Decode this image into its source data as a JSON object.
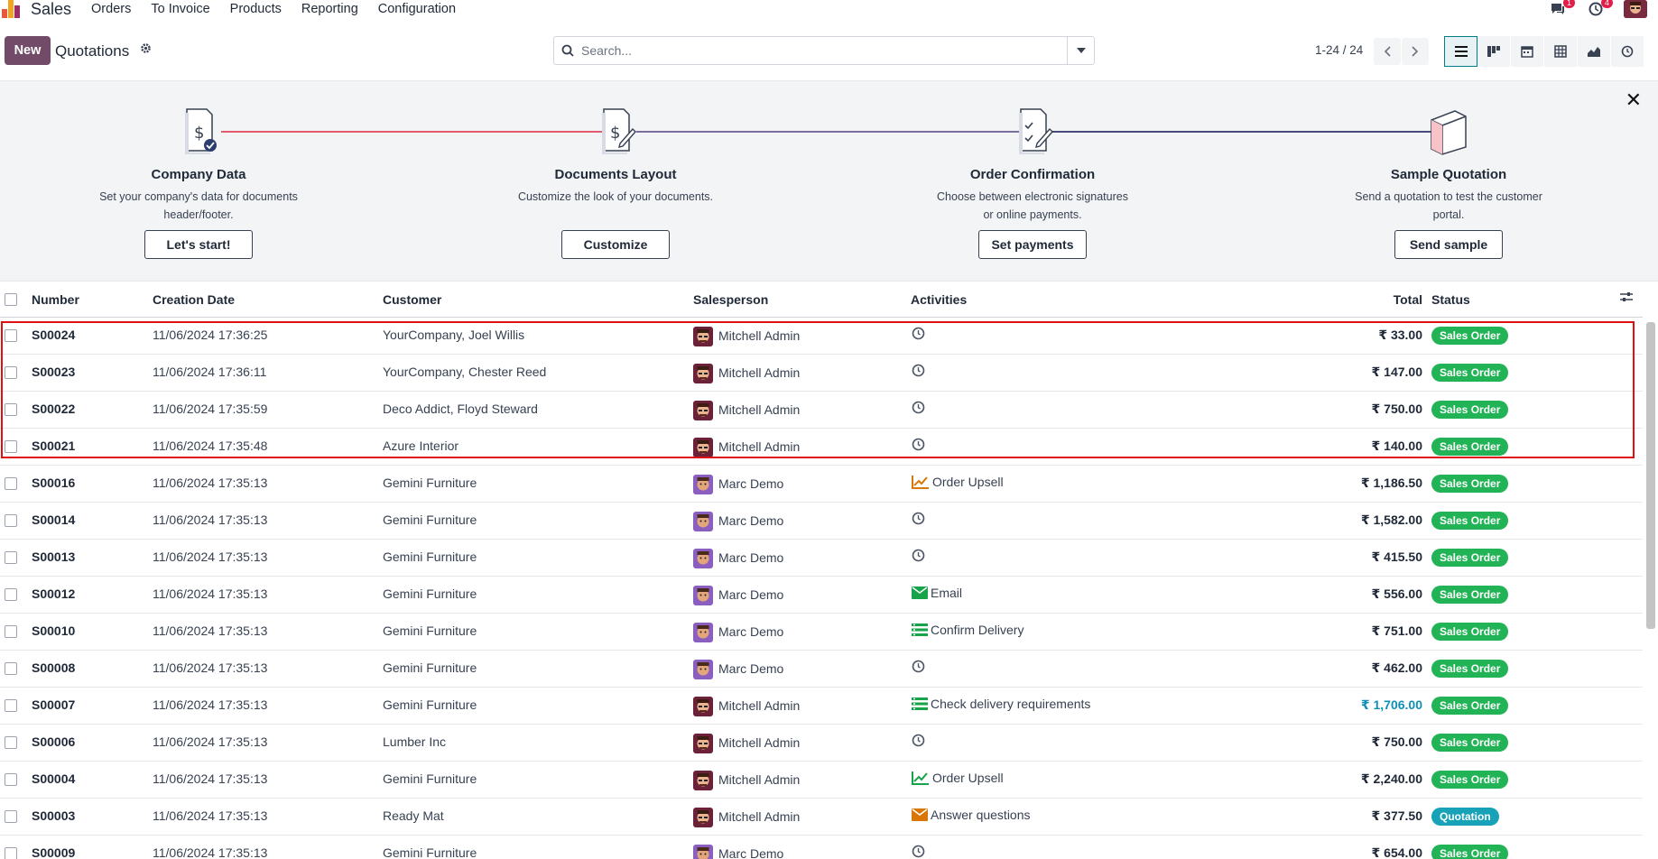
{
  "nav": {
    "app_name": "Sales",
    "menu": [
      "Orders",
      "To Invoice",
      "Products",
      "Reporting",
      "Configuration"
    ],
    "messages_badge": "1",
    "activities_badge": "4"
  },
  "control": {
    "new_label": "New",
    "title": "Quotations",
    "search_placeholder": "Search...",
    "pager": "1-24 / 24"
  },
  "onboarding": [
    {
      "title": "Company Data",
      "desc": "Set your company's data for documents header/footer.",
      "button": "Let's start!"
    },
    {
      "title": "Documents Layout",
      "desc": "Customize the look of your documents.",
      "button": "Customize"
    },
    {
      "title": "Order Confirmation",
      "desc": "Choose between electronic signatures or online payments.",
      "button": "Set payments"
    },
    {
      "title": "Sample Quotation",
      "desc": "Send a quotation to test the customer portal.",
      "button": "Send sample"
    }
  ],
  "table": {
    "headers": {
      "number": "Number",
      "date": "Creation Date",
      "customer": "Customer",
      "salesperson": "Salesperson",
      "activities": "Activities",
      "total": "Total",
      "status": "Status"
    },
    "rows": [
      {
        "number": "S00024",
        "date": "11/06/2024 17:36:25",
        "customer": "YourCompany, Joel Willis",
        "salesperson": "Mitchell Admin",
        "avatar": "mitchell",
        "activity": "",
        "activity_icon": "clock-icon",
        "total": "₹ 33.00",
        "status": "Sales Order",
        "status_color": "#21b356"
      },
      {
        "number": "S00023",
        "date": "11/06/2024 17:36:11",
        "customer": "YourCompany, Chester Reed",
        "salesperson": "Mitchell Admin",
        "avatar": "mitchell",
        "activity": "",
        "activity_icon": "clock-icon",
        "total": "₹ 147.00",
        "status": "Sales Order",
        "status_color": "#21b356"
      },
      {
        "number": "S00022",
        "date": "11/06/2024 17:35:59",
        "customer": "Deco Addict, Floyd Steward",
        "salesperson": "Mitchell Admin",
        "avatar": "mitchell",
        "activity": "",
        "activity_icon": "clock-icon",
        "total": "₹ 750.00",
        "status": "Sales Order",
        "status_color": "#21b356"
      },
      {
        "number": "S00021",
        "date": "11/06/2024 17:35:48",
        "customer": "Azure Interior",
        "salesperson": "Mitchell Admin",
        "avatar": "mitchell",
        "activity": "",
        "activity_icon": "clock-icon",
        "total": "₹ 140.00",
        "status": "Sales Order",
        "status_color": "#21b356"
      },
      {
        "number": "S00016",
        "date": "11/06/2024 17:35:13",
        "customer": "Gemini Furniture",
        "salesperson": "Marc Demo",
        "avatar": "marc",
        "activity": "Order Upsell",
        "activity_icon": "upsell-chart-icon-orange",
        "total": "₹ 1,186.50",
        "status": "Sales Order",
        "status_color": "#21b356"
      },
      {
        "number": "S00014",
        "date": "11/06/2024 17:35:13",
        "customer": "Gemini Furniture",
        "salesperson": "Marc Demo",
        "avatar": "marc",
        "activity": "",
        "activity_icon": "clock-icon",
        "total": "₹ 1,582.00",
        "status": "Sales Order",
        "status_color": "#21b356"
      },
      {
        "number": "S00013",
        "date": "11/06/2024 17:35:13",
        "customer": "Gemini Furniture",
        "salesperson": "Marc Demo",
        "avatar": "marc",
        "activity": "",
        "activity_icon": "clock-icon",
        "total": "₹ 415.50",
        "status": "Sales Order",
        "status_color": "#21b356"
      },
      {
        "number": "S00012",
        "date": "11/06/2024 17:35:13",
        "customer": "Gemini Furniture",
        "salesperson": "Marc Demo",
        "avatar": "marc",
        "activity": "Email",
        "activity_icon": "email-icon-green",
        "total": "₹ 556.00",
        "status": "Sales Order",
        "status_color": "#21b356"
      },
      {
        "number": "S00010",
        "date": "11/06/2024 17:35:13",
        "customer": "Gemini Furniture",
        "salesperson": "Marc Demo",
        "avatar": "marc",
        "activity": "Confirm Delivery",
        "activity_icon": "todo-list-icon-green",
        "total": "₹ 751.00",
        "status": "Sales Order",
        "status_color": "#21b356"
      },
      {
        "number": "S00008",
        "date": "11/06/2024 17:35:13",
        "customer": "Gemini Furniture",
        "salesperson": "Marc Demo",
        "avatar": "marc",
        "activity": "",
        "activity_icon": "clock-icon",
        "total": "₹ 462.00",
        "status": "Sales Order",
        "status_color": "#21b356"
      },
      {
        "number": "S00007",
        "date": "11/06/2024 17:35:13",
        "customer": "Gemini Furniture",
        "salesperson": "Mitchell Admin",
        "avatar": "mitchell",
        "activity": "Check delivery requirements",
        "activity_icon": "todo-list-icon-green",
        "total": "₹ 1,706.00",
        "total_link": true,
        "status": "Sales Order",
        "status_color": "#21b356"
      },
      {
        "number": "S00006",
        "date": "11/06/2024 17:35:13",
        "customer": "Lumber Inc",
        "salesperson": "Mitchell Admin",
        "avatar": "mitchell",
        "activity": "",
        "activity_icon": "clock-icon",
        "total": "₹ 750.00",
        "status": "Sales Order",
        "status_color": "#21b356"
      },
      {
        "number": "S00004",
        "date": "11/06/2024 17:35:13",
        "customer": "Gemini Furniture",
        "salesperson": "Mitchell Admin",
        "avatar": "mitchell",
        "activity": "Order Upsell",
        "activity_icon": "upsell-chart-icon-green",
        "total": "₹ 2,240.00",
        "status": "Sales Order",
        "status_color": "#21b356"
      },
      {
        "number": "S00003",
        "date": "11/06/2024 17:35:13",
        "customer": "Ready Mat",
        "salesperson": "Mitchell Admin",
        "avatar": "mitchell",
        "activity": "Answer questions",
        "activity_icon": "email-icon-orange",
        "total": "₹ 377.50",
        "status": "Quotation",
        "status_color": "#17a2b8"
      },
      {
        "number": "S00009",
        "date": "11/06/2024 17:35:13",
        "customer": "Gemini Furniture",
        "salesperson": "Marc Demo",
        "avatar": "marc",
        "activity": "",
        "activity_icon": "clock-icon",
        "total": "₹ 654.00",
        "status": "Sales Order",
        "status_color": "#21b356"
      }
    ]
  },
  "colors": {
    "brand": "#714b67",
    "accent": "#017e84",
    "highlight": "#dd1111"
  }
}
